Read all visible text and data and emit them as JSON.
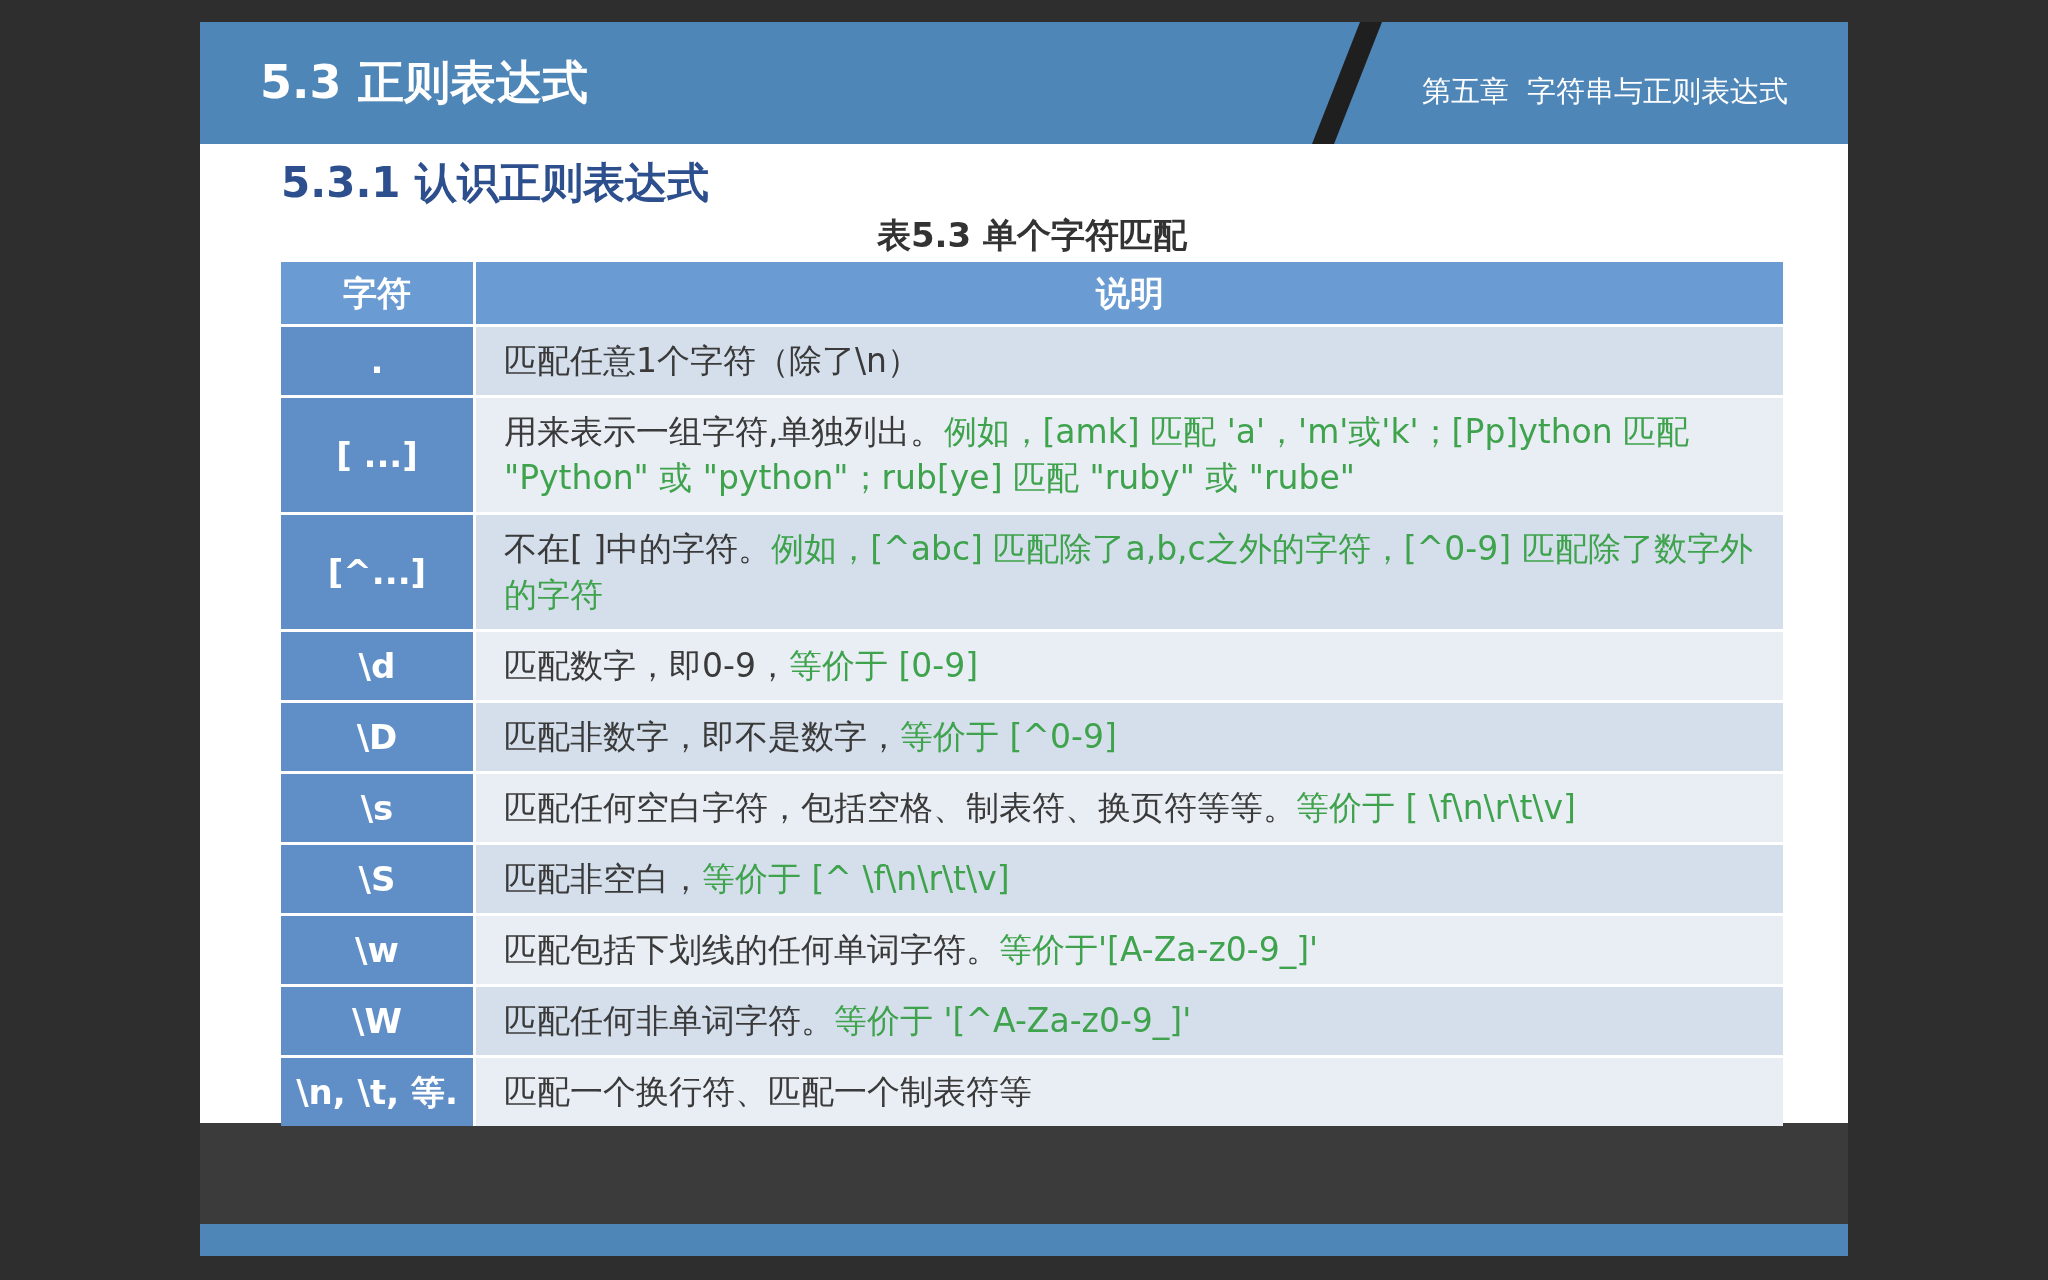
{
  "slide": {
    "title": "5.3  正则表达式",
    "chapter": "第五章  字符串与正则表达式",
    "section": "5.3.1 认识正则表达式"
  },
  "table": {
    "caption": "表5.3 单个字符匹配",
    "columns": [
      "字符",
      "说明"
    ],
    "rows": [
      {
        "symbol": ".",
        "description": [
          {
            "kind": "plain",
            "text": "匹配任意1个字符（除了\\n）"
          }
        ]
      },
      {
        "symbol": "[ ...]",
        "description": [
          {
            "kind": "plain",
            "text": "用来表示一组字符,单独列出。"
          },
          {
            "kind": "example",
            "text": "例如，[amk]  匹配  'a'，'m'或'k'；[Pp]ython 匹配 \"Python\" 或 \"python\"；rub[ye] 匹配 \"ruby\" 或 \"rube\""
          }
        ]
      },
      {
        "symbol": "[^...]",
        "description": [
          {
            "kind": "plain",
            "text": "不在[ ]中的字符。"
          },
          {
            "kind": "example",
            "text": "例如，[^abc] 匹配除了a,b,c之外的字符，[^0-9] 匹配除了数字外的字符"
          }
        ]
      },
      {
        "symbol": "\\d",
        "description": [
          {
            "kind": "plain",
            "text": "匹配数字，即0-9，"
          },
          {
            "kind": "example",
            "text": "等价于 [0-9]"
          }
        ]
      },
      {
        "symbol": "\\D",
        "description": [
          {
            "kind": "plain",
            "text": "匹配非数字，即不是数字，"
          },
          {
            "kind": "example",
            "text": "等价于 [^0-9]"
          }
        ]
      },
      {
        "symbol": "\\s",
        "description": [
          {
            "kind": "plain",
            "text": "匹配任何空白字符，包括空格、制表符、换页符等等。"
          },
          {
            "kind": "example",
            "text": "等价于 [ \\f\\n\\r\\t\\v]"
          }
        ]
      },
      {
        "symbol": "\\S",
        "description": [
          {
            "kind": "plain",
            "text": "匹配非空白，"
          },
          {
            "kind": "example",
            "text": "等价于 [^ \\f\\n\\r\\t\\v]"
          }
        ]
      },
      {
        "symbol": "\\w",
        "description": [
          {
            "kind": "plain",
            "text": "匹配包括下划线的任何单词字符。"
          },
          {
            "kind": "example",
            "text": "等价于'[A-Za-z0-9_]'"
          }
        ]
      },
      {
        "symbol": "\\W",
        "description": [
          {
            "kind": "plain",
            "text": "匹配任何非单词字符。"
          },
          {
            "kind": "example",
            "text": "等价于 '[^A-Za-z0-9_]'"
          }
        ]
      },
      {
        "symbol": "\\n, \\t, 等.",
        "description": [
          {
            "kind": "plain",
            "text": "匹配一个换行符、匹配一个制表符等"
          }
        ]
      }
    ]
  }
}
